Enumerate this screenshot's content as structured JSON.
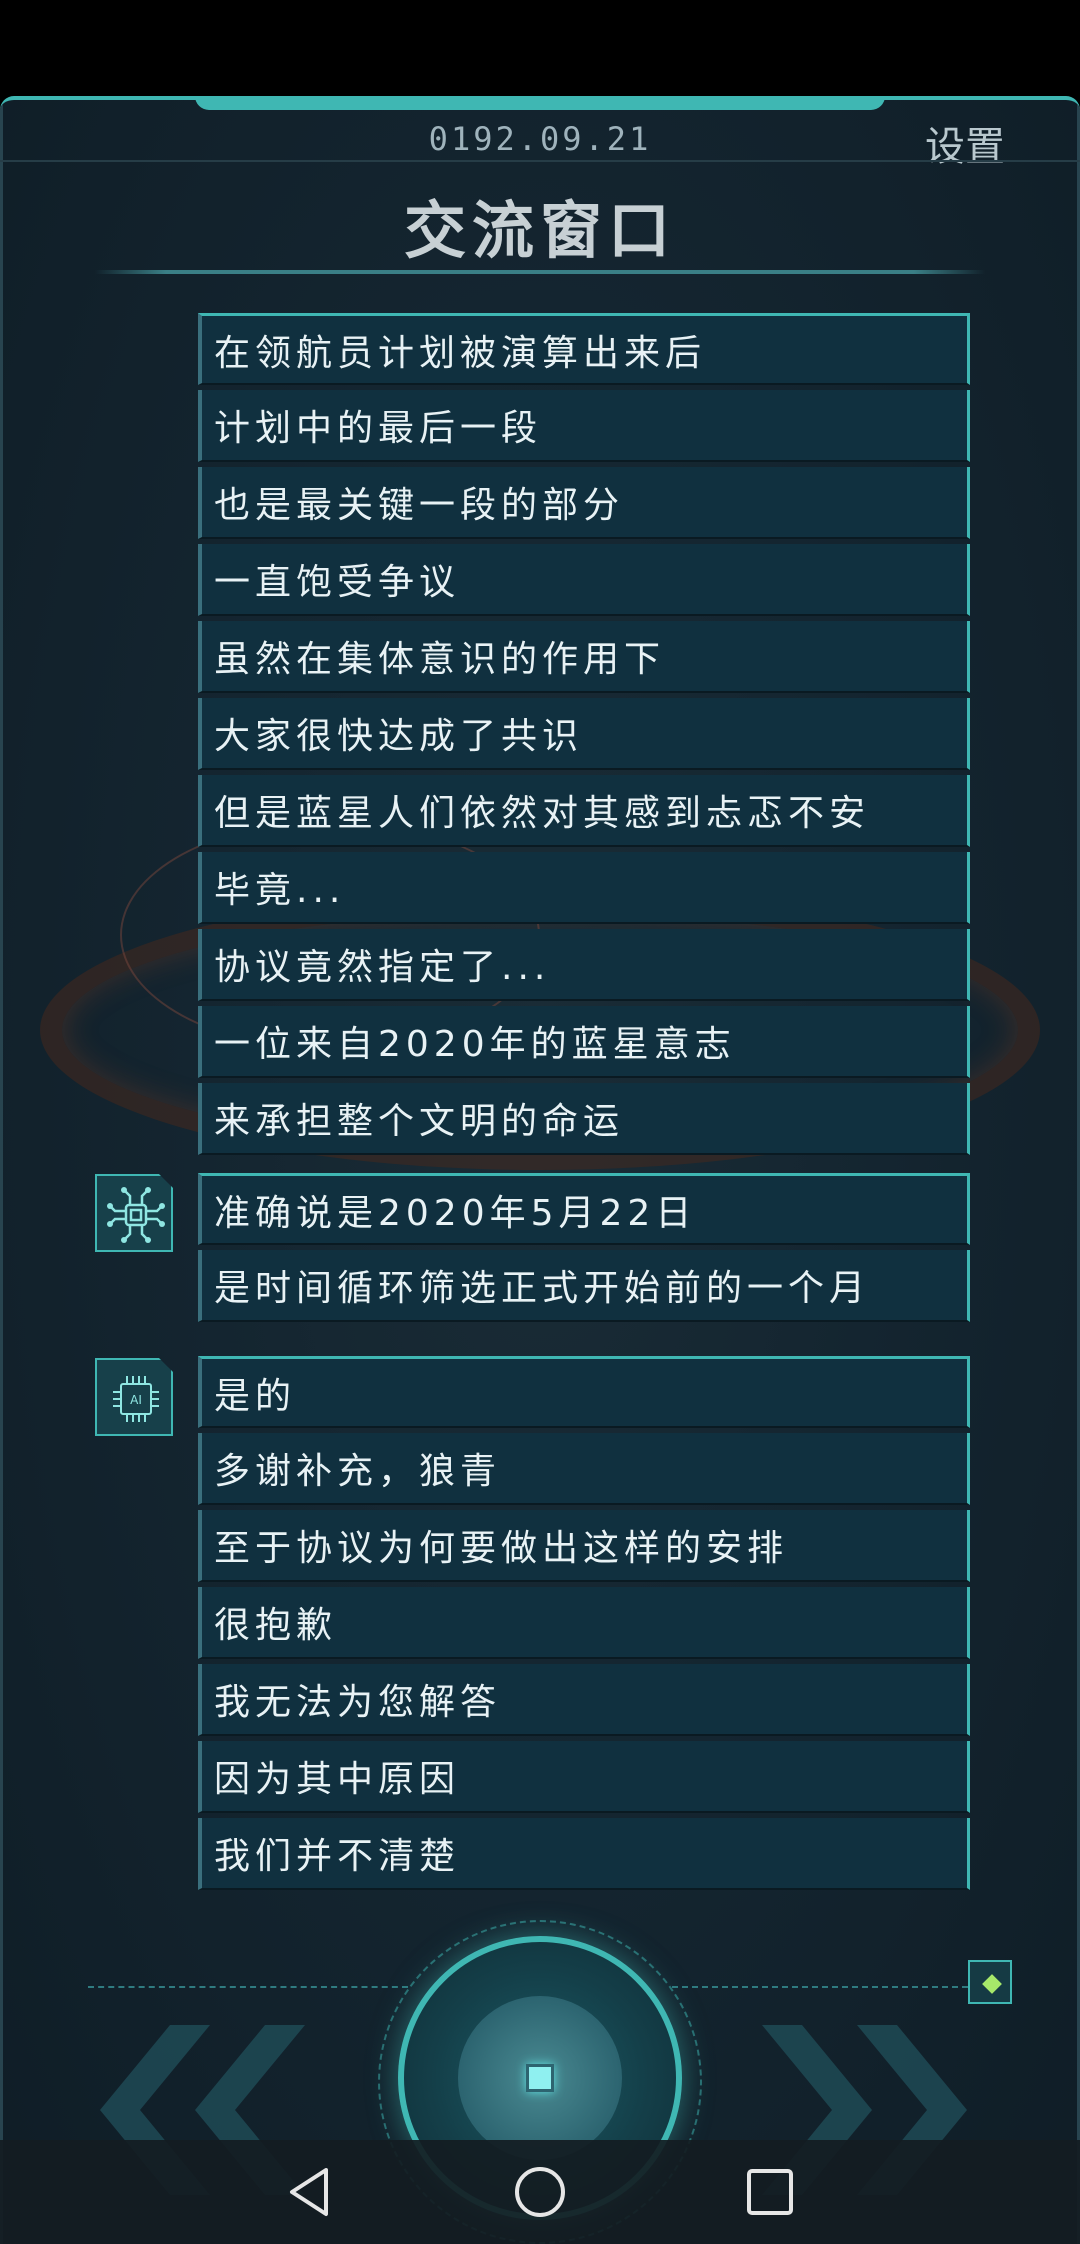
{
  "header": {
    "date": "0192.09.21",
    "settings_label": "设置",
    "title": "交流窗口"
  },
  "messages": [
    {
      "text": "在领航员计划被演算出来后",
      "group": 0
    },
    {
      "text": "计划中的最后一段",
      "group": 0
    },
    {
      "text": "也是最关键一段的部分",
      "group": 0
    },
    {
      "text": "一直饱受争议",
      "group": 0
    },
    {
      "text": "虽然在集体意识的作用下",
      "group": 0
    },
    {
      "text": "大家很快达成了共识",
      "group": 0
    },
    {
      "text": "但是蓝星人们依然对其感到忐忑不安",
      "group": 0
    },
    {
      "text": "毕竟...",
      "group": 0
    },
    {
      "text": "协议竟然指定了...",
      "group": 0
    },
    {
      "text": "一位来自2020年的蓝星意志",
      "group": 0
    },
    {
      "text": "来承担整个文明的命运",
      "group": 0
    },
    {
      "text": "准确说是2020年5月22日",
      "group": 1
    },
    {
      "text": "是时间循环筛选正式开始前的一个月",
      "group": 1
    },
    {
      "text": "是的",
      "group": 2
    },
    {
      "text": "多谢补充，狼青",
      "group": 2
    },
    {
      "text": "至于协议为何要做出这样的安排",
      "group": 2
    },
    {
      "text": "很抱歉",
      "group": 2
    },
    {
      "text": "我无法为您解答",
      "group": 2
    },
    {
      "text": "因为其中原因",
      "group": 2
    },
    {
      "text": "我们并不清楚",
      "group": 2
    }
  ],
  "avatars": [
    {
      "icon": "circuit-bug-icon"
    },
    {
      "icon": "ai-chip-icon",
      "text": "AI"
    }
  ],
  "controls": {
    "prev_icon": "double-chevron-left-icon",
    "next_icon": "double-chevron-right-icon",
    "center_icon": "advance-button-icon",
    "corner_icon": "diamond-gem-icon"
  },
  "navbar": {
    "back_icon": "triangle-back-icon",
    "home_icon": "circle-home-icon",
    "recents_icon": "square-recents-icon"
  },
  "colors": {
    "accent": "#3fb7b3",
    "bubble": "#10303f",
    "panel": "#142530",
    "gem": "#a6e86a"
  }
}
